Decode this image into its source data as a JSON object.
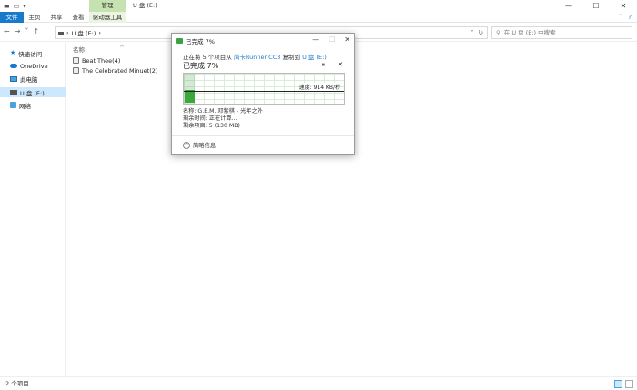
{
  "titlebar": {
    "manage_tab": "管理",
    "title": "U 盘 (E:)",
    "qa_icons": [
      "save-icon",
      "folder-icon",
      "dropdown-icon"
    ],
    "minimize": "—",
    "maximize": "☐",
    "close": "✕"
  },
  "ribbon": {
    "tabs": [
      "文件",
      "主页",
      "共享",
      "查看",
      "驱动器工具"
    ],
    "chevron": "˅",
    "help": "?"
  },
  "navbar": {
    "back": "←",
    "forward": "→",
    "up": "↑",
    "path": [
      "U 盘 (E:)"
    ],
    "search_placeholder": "在 U 盘 (E:) 中搜索"
  },
  "sidebar": {
    "items": [
      {
        "label": "快速访问",
        "icon": "star-icon"
      },
      {
        "label": "OneDrive",
        "icon": "cloud-icon"
      },
      {
        "label": "此电脑",
        "icon": "pc-icon"
      },
      {
        "label": "U 盘 (E:)",
        "icon": "drive-icon",
        "selected": true
      },
      {
        "label": "网络",
        "icon": "network-icon"
      }
    ]
  },
  "content": {
    "column_header": "名称",
    "items": [
      "Beat Thee(4)",
      "The Celebrated Minuet(2)"
    ]
  },
  "statusbar": {
    "text": "2 个项目"
  },
  "dialog": {
    "title": "已完成 7%",
    "line_prefix": "正在将 5 个项目从",
    "source": "简卡Runner CC3",
    "line_mid": "复制到",
    "dest": "U 盘 (E:)",
    "percent": "已完成 7%",
    "pause": "⏸",
    "cancel": "✕",
    "speed": "速度: 914 KB/秒",
    "progress": 0.07,
    "name": "名称: G.E.M. 邓紫棋 - 光年之外",
    "time_left": "剩余时间: 正在计算...",
    "items_left": "剩余项目: 5 (130 MB)",
    "less_details": "简略信息",
    "accent": "#3ca83c"
  }
}
